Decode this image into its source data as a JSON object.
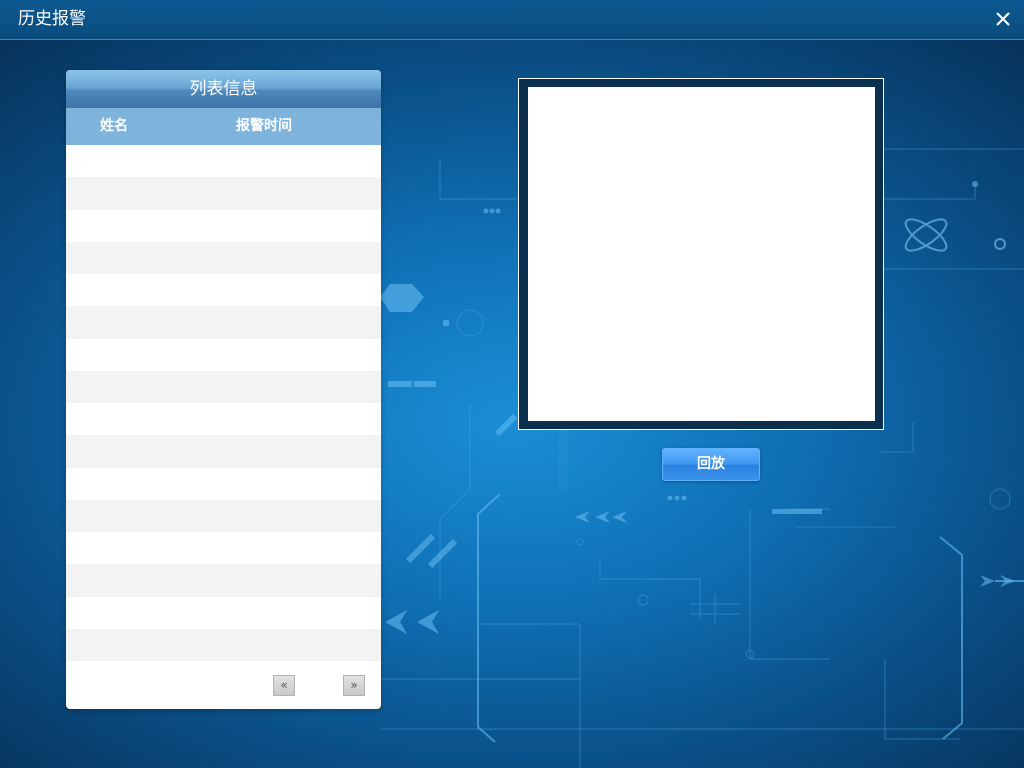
{
  "window": {
    "title": "历史报警",
    "close_icon": "close-icon"
  },
  "list_panel": {
    "title": "列表信息",
    "columns": [
      "姓名",
      "报警时间"
    ],
    "rows": [],
    "pager": {
      "prev_label": "«",
      "next_label": "»"
    }
  },
  "video": {
    "playback_label": "回放"
  },
  "colors": {
    "titlebar": "#0a4c7d",
    "header_row": "#7eb4dc",
    "button": "#3e97ef"
  }
}
